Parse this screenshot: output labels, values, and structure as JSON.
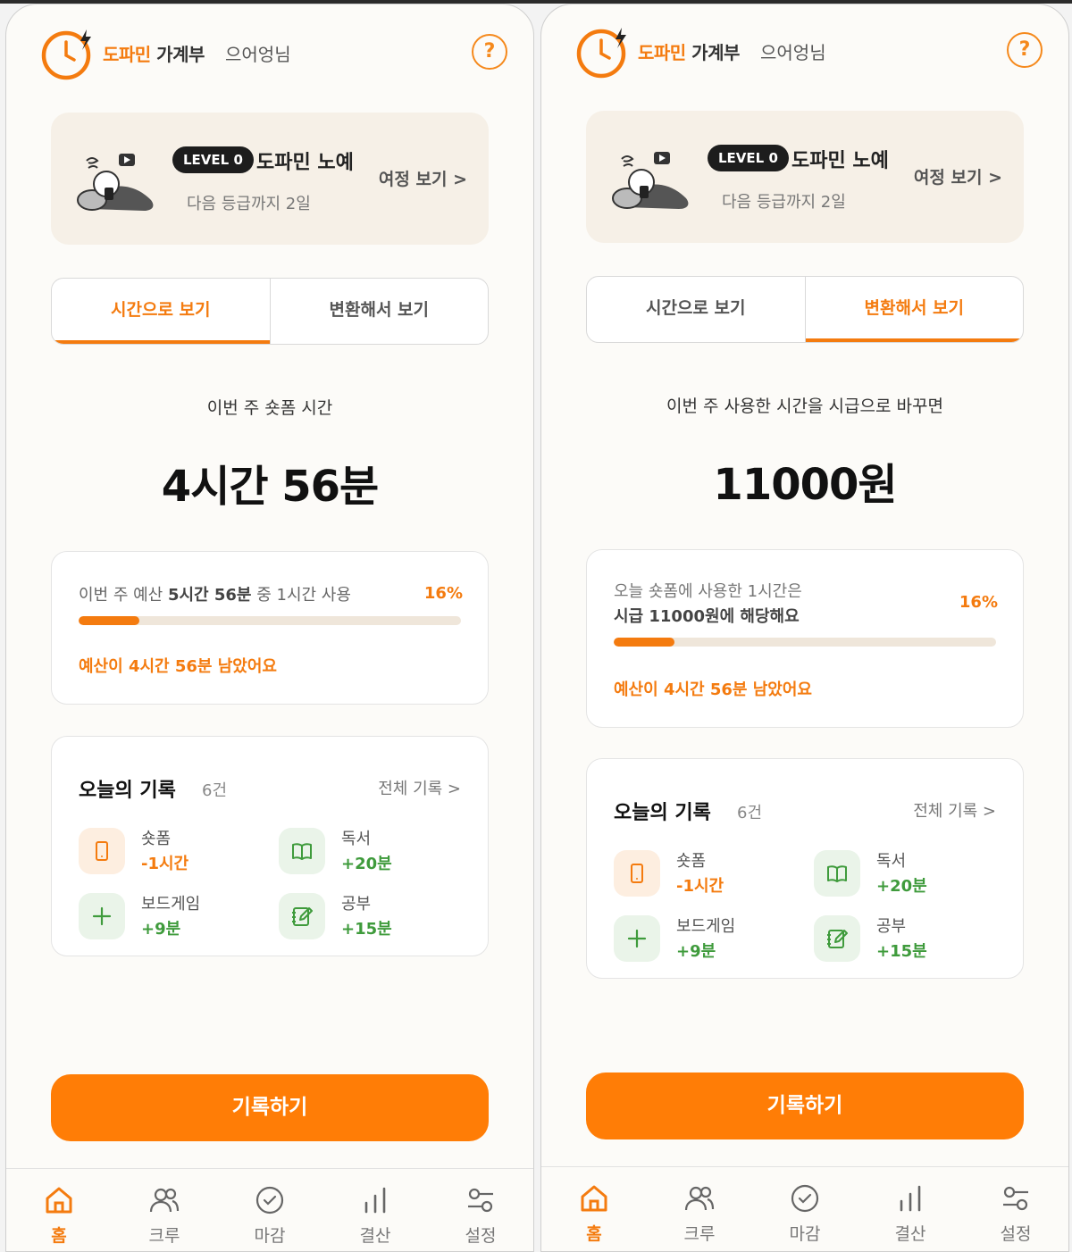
{
  "screens": [
    {
      "header": {
        "brand_accent": "도파민",
        "brand_rest": "가계부",
        "user": "으어엉님",
        "help": "?"
      },
      "level": {
        "badge": "LEVEL 0",
        "name": "도파민 노예",
        "next": "다음 등급까지 2일",
        "journey": "여정 보기 >"
      },
      "tabs": [
        {
          "label": "시간으로 보기",
          "active": true
        },
        {
          "label": "변환해서 보기",
          "active": false
        }
      ],
      "summary": {
        "label": "이번 주 숏폼 시간",
        "value": "4시간 56분"
      },
      "budget": {
        "prefix": "이번 주 예산 ",
        "bold": "5시간 56분",
        "suffix": " 중 1시간 사용",
        "percent_label": "16%",
        "progress": 0.16,
        "remaining": "예산이 4시간 56분 남았어요"
      },
      "records": {
        "title": "오늘의 기록",
        "count": "6건",
        "all": "전체 기록 >",
        "items": [
          {
            "icon": "phone-icon",
            "name": "숏폼",
            "value": "-1시간"
          },
          {
            "icon": "book-icon",
            "name": "독서",
            "value": "+20분"
          },
          {
            "icon": "plus-icon",
            "name": "보드게임",
            "value": "+9분"
          },
          {
            "icon": "note-pencil-icon",
            "name": "공부",
            "value": "+15분"
          }
        ]
      },
      "record_button": "기록하기",
      "nav": [
        {
          "label": "홈",
          "icon": "home-icon"
        },
        {
          "label": "크루",
          "icon": "people-icon"
        },
        {
          "label": "마감",
          "icon": "check-circle-icon"
        },
        {
          "label": "결산",
          "icon": "bar-chart-icon"
        },
        {
          "label": "설정",
          "icon": "settings-icon"
        }
      ]
    },
    {
      "header": {
        "brand_accent": "도파민",
        "brand_rest": "가계부",
        "user": "으어엉님",
        "help": "?"
      },
      "level": {
        "badge": "LEVEL 0",
        "name": "도파민 노예",
        "next": "다음 등급까지 2일",
        "journey": "여정 보기 >"
      },
      "tabs": [
        {
          "label": "시간으로 보기",
          "active": false
        },
        {
          "label": "변환해서 보기",
          "active": true
        }
      ],
      "summary": {
        "label": "이번 주 사용한 시간을 시급으로 바꾸면",
        "value": "11000원"
      },
      "budget": {
        "line1": "오늘 숏폼에 사용한 1시간은",
        "line2": "시급 11000원에 해당해요",
        "percent_label": "16%",
        "progress": 0.16,
        "remaining": "예산이 4시간 56분 남았어요"
      },
      "records": {
        "title": "오늘의 기록",
        "count": "6건",
        "all": "전체 기록 >",
        "items": [
          {
            "icon": "phone-icon",
            "name": "숏폼",
            "value": "-1시간"
          },
          {
            "icon": "book-icon",
            "name": "독서",
            "value": "+20분"
          },
          {
            "icon": "plus-icon",
            "name": "보드게임",
            "value": "+9분"
          },
          {
            "icon": "note-pencil-icon",
            "name": "공부",
            "value": "+15분"
          }
        ]
      },
      "record_button": "기록하기",
      "nav": [
        {
          "label": "홈",
          "icon": "home-icon"
        },
        {
          "label": "크루",
          "icon": "people-icon"
        },
        {
          "label": "마감",
          "icon": "check-circle-icon"
        },
        {
          "label": "결산",
          "icon": "bar-chart-icon"
        },
        {
          "label": "설정",
          "icon": "settings-icon"
        }
      ]
    }
  ],
  "colors": {
    "accent": "#f47b0f",
    "positive": "#3f9b3c",
    "card_beige": "#f6f0e7"
  }
}
